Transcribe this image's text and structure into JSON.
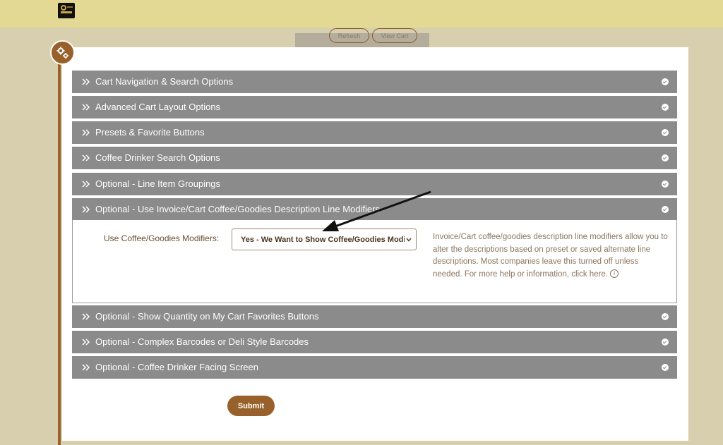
{
  "header": {
    "logo_icon": "company-logo"
  },
  "toolbar": {
    "refresh_label": "Refresh",
    "view_cart_label": "View Cart"
  },
  "section_icon": "gears-icon",
  "accordion": {
    "items": [
      {
        "label": "Cart Navigation & Search Options",
        "expanded": false
      },
      {
        "label": "Advanced Cart Layout Options",
        "expanded": false
      },
      {
        "label": "Presets & Favorite Buttons",
        "expanded": false
      },
      {
        "label": "Coffee Drinker Search Options",
        "expanded": false
      },
      {
        "label": "Optional - Line Item Groupings",
        "expanded": false
      },
      {
        "label": "Optional - Use Invoice/Cart Coffee/Goodies Description Line Modifiers",
        "expanded": true
      },
      {
        "label": "Optional - Show Quantity on My Cart Favorites Buttons",
        "expanded": false
      },
      {
        "label": "Optional - Complex Barcodes or Deli Style Barcodes",
        "expanded": false
      },
      {
        "label": "Optional - Coffee Drinker Facing Screen",
        "expanded": false
      }
    ]
  },
  "modifiers": {
    "field_label": "Use Coffee/Goodies Modifiers:",
    "selected_value": "Yes - We Want to Show Coffee/Goodies Modifiers",
    "help_text": "Invoice/Cart coffee/goodies description line modifiers allow you to alter the descriptions based on preset or saved alternate line descriptions. Most companies leave this turned off unless needed. For more help or information, click here.",
    "info_icon": "info-icon"
  },
  "form": {
    "submit_label": "Submit"
  },
  "colors": {
    "accent_brown": "#98602a",
    "accordion_gray": "#8b8b8b",
    "topbar": "#e3d894",
    "background": "#d8cfae"
  }
}
